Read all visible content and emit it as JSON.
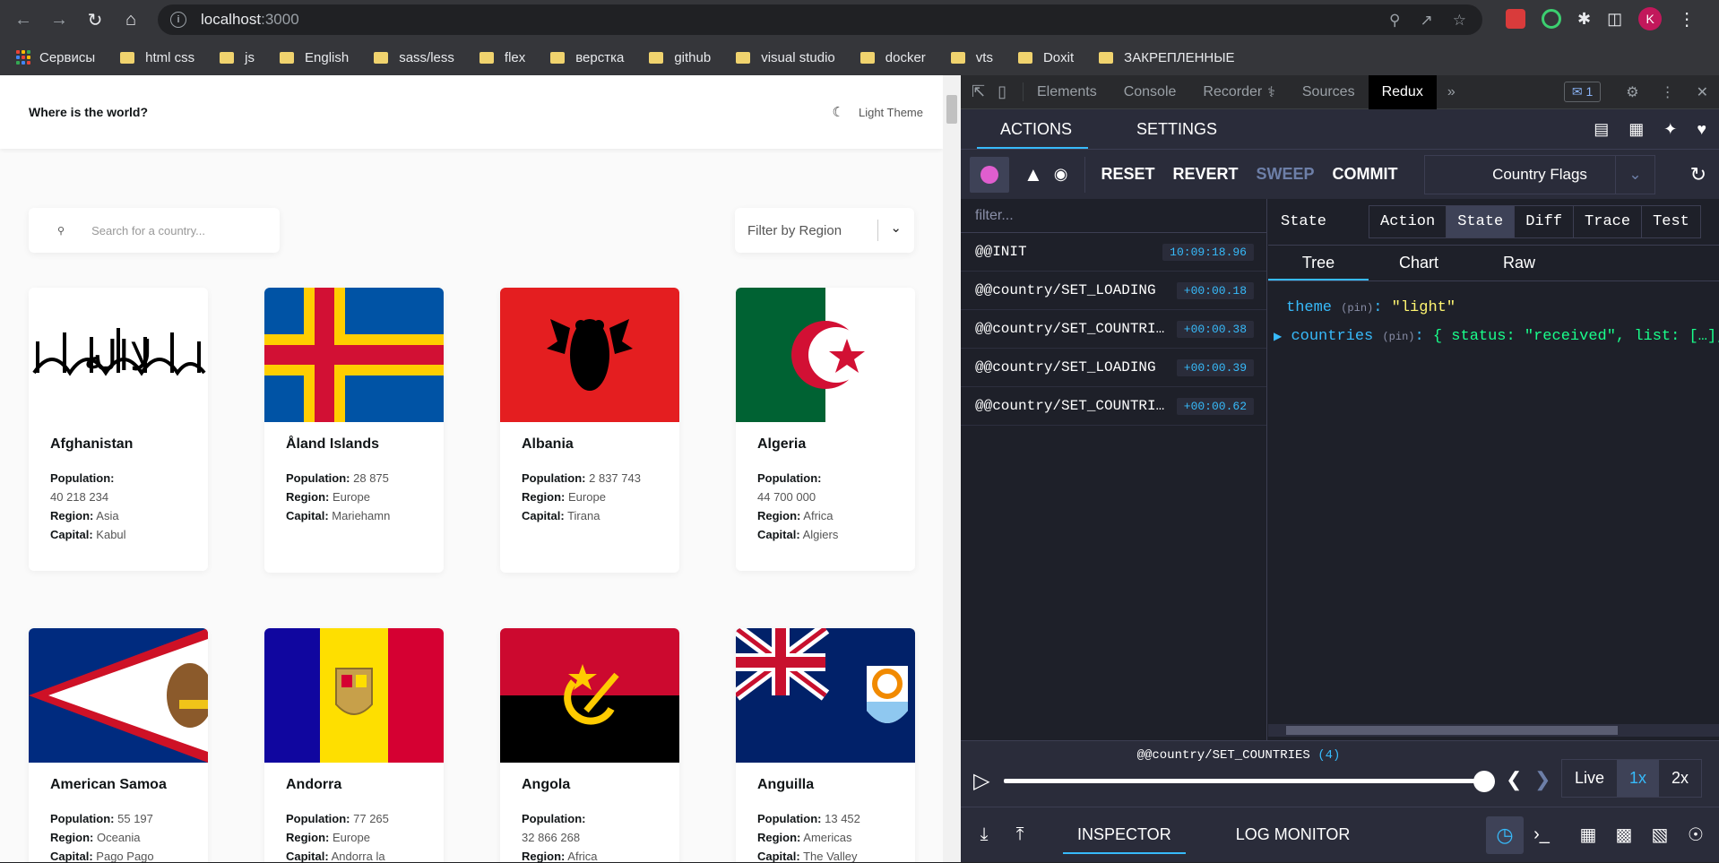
{
  "browser": {
    "url_host": "localhost",
    "url_port": ":3000",
    "bookmarks": [
      "Сервисы",
      "html css",
      "js",
      "English",
      "sass/less",
      "flex",
      "верстка",
      "github",
      "visual studio",
      "docker",
      "vts",
      "Doxit",
      "ЗАКРЕПЛЕННЫЕ"
    ],
    "avatar_letter": "K"
  },
  "app": {
    "brand": "Where is the world?",
    "theme_label": "Light Theme",
    "search_placeholder": "Search for a country...",
    "filter_label": "Filter by Region",
    "labels": {
      "population": "Population:",
      "region": "Region:",
      "capital": "Capital:"
    },
    "countries": [
      {
        "name": "Afghanistan",
        "population": "40 218 234",
        "region": "Asia",
        "capital": "Kabul"
      },
      {
        "name": "Åland Islands",
        "population": "28 875",
        "region": "Europe",
        "capital": "Mariehamn"
      },
      {
        "name": "Albania",
        "population": "2 837 743",
        "region": "Europe",
        "capital": "Tirana"
      },
      {
        "name": "Algeria",
        "population": "44 700 000",
        "region": "Africa",
        "capital": "Algiers"
      },
      {
        "name": "American Samoa",
        "population": "55 197",
        "region": "Oceania",
        "capital": "Pago Pago"
      },
      {
        "name": "Andorra",
        "population": "77 265",
        "region": "Europe",
        "capital": "Andorra la"
      },
      {
        "name": "Angola",
        "population": "32 866 268",
        "region": "Africa",
        "capital": ""
      },
      {
        "name": "Anguilla",
        "population": "13 452",
        "region": "Americas",
        "capital": "The Valley"
      }
    ]
  },
  "devtools": {
    "tabs": [
      "Elements",
      "Console",
      "Recorder",
      "Sources",
      "Redux"
    ],
    "active_tab": "Redux",
    "issues_count": "1",
    "redux": {
      "top_tabs": [
        "ACTIONS",
        "SETTINGS"
      ],
      "toolbar": [
        "RESET",
        "REVERT",
        "SWEEP",
        "COMMIT"
      ],
      "instance": "Country Flags",
      "filter_placeholder": "filter...",
      "actions": [
        {
          "type": "@@INIT",
          "time": "10:09:18.96"
        },
        {
          "type": "@@country/SET_LOADING",
          "time": "+00:00.18"
        },
        {
          "type": "@@country/SET_COUNTRI…",
          "time": "+00:00.38"
        },
        {
          "type": "@@country/SET_LOADING",
          "time": "+00:00.39"
        },
        {
          "type": "@@country/SET_COUNTRI…",
          "time": "+00:00.62"
        }
      ],
      "state_label": "State",
      "monitor_tabs": [
        "Action",
        "State",
        "Diff",
        "Trace",
        "Test"
      ],
      "view_tabs": [
        "Tree",
        "Chart",
        "Raw"
      ],
      "tree": {
        "k1": "theme",
        "v1": "\"light\"",
        "k2": "countries",
        "v2": "{ status: \"received\", list: […], e",
        "pin": "(pin)"
      },
      "slider_action": "@@country/SET_COUNTRIES",
      "slider_count": "(4)",
      "speeds": [
        "Live",
        "1x",
        "2x"
      ],
      "bottom_tabs": [
        "INSPECTOR",
        "LOG MONITOR"
      ]
    }
  }
}
